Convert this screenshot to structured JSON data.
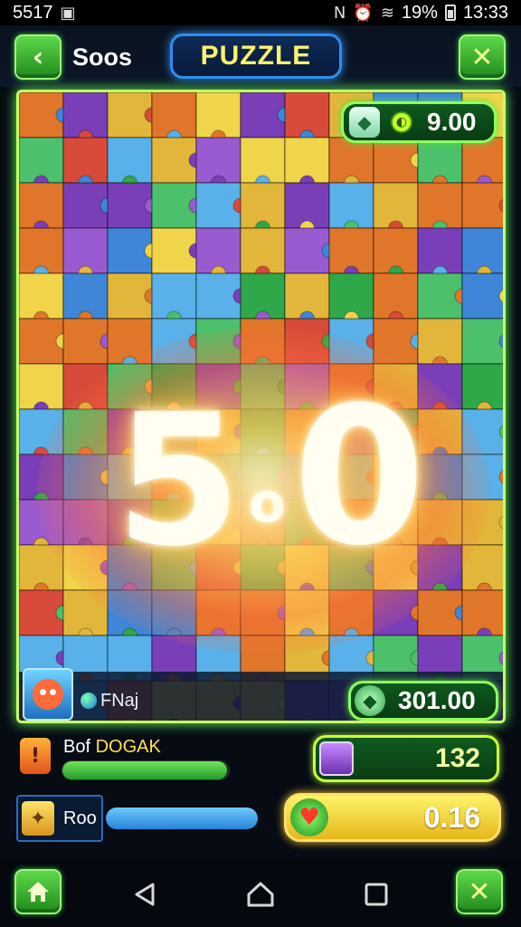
{
  "status_bar": {
    "left_text": "5517",
    "battery": "19%",
    "time": "13:33"
  },
  "header": {
    "back_icon": "chevron-left-icon",
    "label": "Soos",
    "title": "PUZZLE",
    "close_icon": "close-icon"
  },
  "board": {
    "top_pill": {
      "value": "9.00"
    },
    "big_score": {
      "digit1": "5",
      "mid": "o",
      "digit2": "0"
    },
    "player": {
      "name": "FNaj"
    },
    "bottom_pill": {
      "value": "301.00"
    }
  },
  "stats": {
    "row1": {
      "label_prefix": "Bof",
      "label_highlight": "DOGAK",
      "progress": 0.99,
      "value": "132"
    },
    "row2": {
      "label": "Roo",
      "progress": 1.0,
      "value": "0.16"
    }
  },
  "nav": {
    "home_icon": "home-icon",
    "close_icon": "close-icon"
  },
  "colors": {
    "accent_green": "#5fd84a",
    "title_yellow": "#fff36a",
    "board_border": "#c6ff64",
    "timer_gold": "#e5b81c"
  }
}
